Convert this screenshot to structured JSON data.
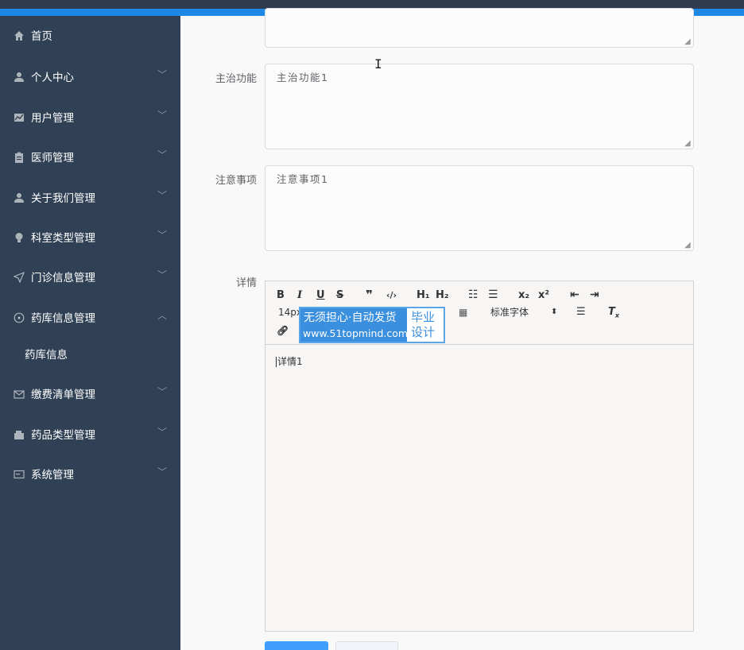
{
  "sidebar": {
    "items": [
      {
        "label": "首页",
        "icon": "home-icon"
      },
      {
        "label": "个人中心",
        "icon": "user-icon"
      },
      {
        "label": "用户管理",
        "icon": "chart-icon"
      },
      {
        "label": "医师管理",
        "icon": "clipboard-icon"
      },
      {
        "label": "关于我们管理",
        "icon": "user-icon"
      },
      {
        "label": "科室类型管理",
        "icon": "bulb-icon"
      },
      {
        "label": "门诊信息管理",
        "icon": "send-icon"
      },
      {
        "label": "药库信息管理",
        "icon": "compass-icon"
      },
      {
        "label": "药库信息"
      },
      {
        "label": "缴费清单管理",
        "icon": "mail-icon"
      },
      {
        "label": "药品类型管理",
        "icon": "wallet-icon"
      },
      {
        "label": "系统管理",
        "icon": "system-icon"
      }
    ]
  },
  "form": {
    "zhuzhi_label": "主治功能",
    "zhuzhi_value": "主治功能1",
    "zhuyi_label": "注意事项",
    "zhuyi_value": "注意事项1",
    "detail_label": "详情"
  },
  "editor": {
    "font_size": "14px",
    "font_family": "标准字体",
    "h1": "H₁",
    "h2": "H₂",
    "content": "详情1"
  },
  "watermark": {
    "line1": "无须担心·自动发货",
    "line2": "www.51topmind.com",
    "right": "毕业设计"
  }
}
